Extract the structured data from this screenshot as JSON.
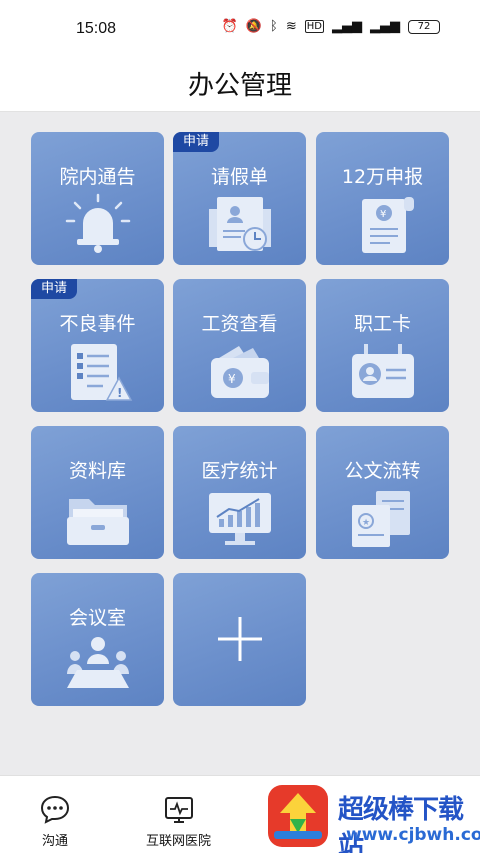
{
  "status_bar": {
    "time": "15:08",
    "battery": "72"
  },
  "header": {
    "title": "办公管理"
  },
  "tiles": [
    {
      "label": "院内通告",
      "tag": ""
    },
    {
      "label": "请假单",
      "tag": "申请"
    },
    {
      "label": "12万申报",
      "tag": ""
    },
    {
      "label": "不良事件",
      "tag": "申请"
    },
    {
      "label": "工资查看",
      "tag": ""
    },
    {
      "label": "职工卡",
      "tag": ""
    },
    {
      "label": "资料库",
      "tag": ""
    },
    {
      "label": "医疗统计",
      "tag": ""
    },
    {
      "label": "公文流转",
      "tag": ""
    },
    {
      "label": "会议室",
      "tag": ""
    },
    {
      "label": "",
      "tag": ""
    }
  ],
  "bottom_nav": [
    {
      "label": "沟通",
      "icon": "chat-icon"
    },
    {
      "label": "互联网医院",
      "icon": "hospital-icon"
    }
  ],
  "watermark": {
    "title": "超级棒下载站",
    "url": "www.cjbwh.com"
  },
  "colors": {
    "tile": "#6c90cc",
    "tag": "#1f49a3",
    "watermark": "#2454c6"
  }
}
